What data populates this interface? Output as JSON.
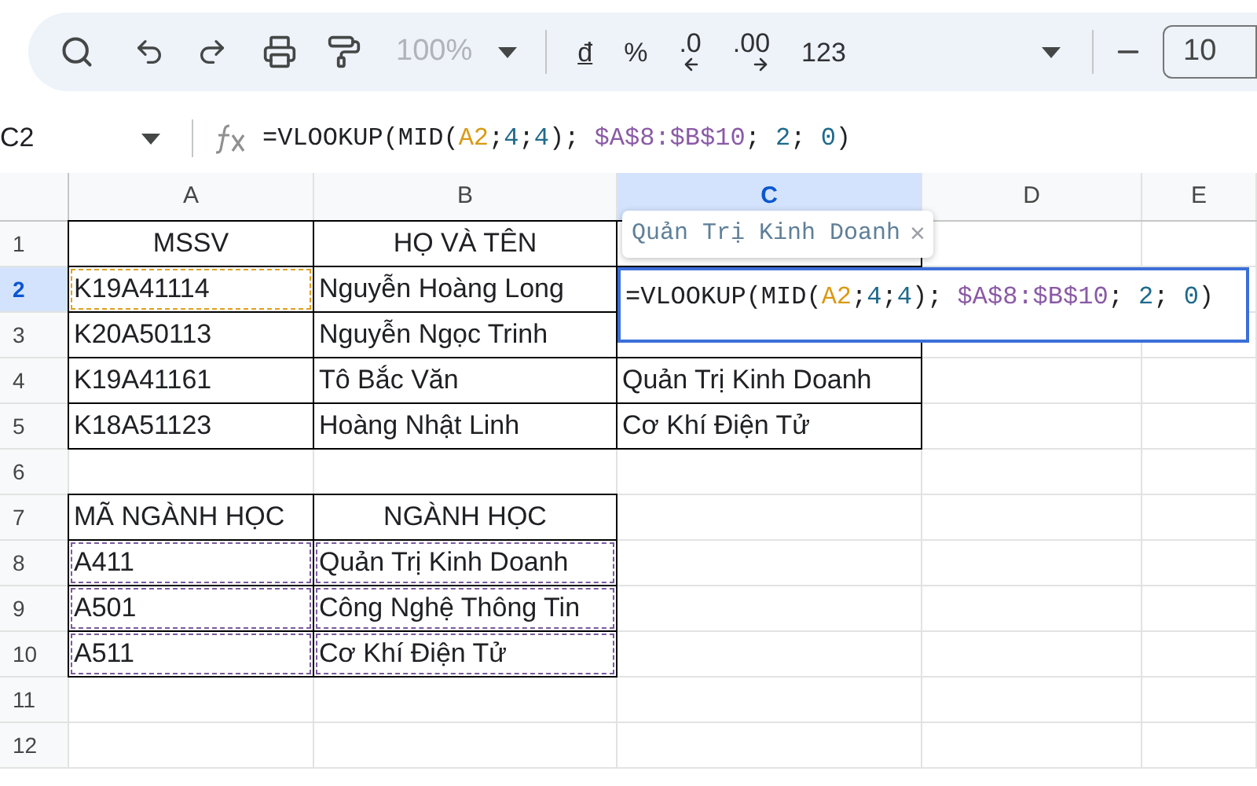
{
  "toolbar": {
    "zoom": "100%",
    "format_buttons": [
      {
        "kind": "plain",
        "label": "đ"
      },
      {
        "kind": "plain",
        "label": "%"
      },
      {
        "kind": "decrease_decimal",
        "label": ".0"
      },
      {
        "kind": "increase_decimal",
        "label": ".00"
      },
      {
        "kind": "plain",
        "label": "123"
      }
    ],
    "font_size": "10"
  },
  "formula_bar": {
    "cell_ref": "C2",
    "formula": [
      {
        "kind": "text",
        "text": "=VLOOKUP(MID("
      },
      {
        "kind": "ref",
        "text": "A2"
      },
      {
        "kind": "text",
        "text": ";"
      },
      {
        "kind": "number",
        "text": "4"
      },
      {
        "kind": "text",
        "text": ";"
      },
      {
        "kind": "number",
        "text": "4"
      },
      {
        "kind": "text",
        "text": "); "
      },
      {
        "kind": "range",
        "text": "$A$8:$B$10"
      },
      {
        "kind": "text",
        "text": "; "
      },
      {
        "kind": "number",
        "text": "2"
      },
      {
        "kind": "text",
        "text": "; "
      },
      {
        "kind": "number",
        "text": "0"
      },
      {
        "kind": "text",
        "text": ")"
      }
    ]
  },
  "sheet": {
    "columns": [
      {
        "label": "A",
        "selected": false
      },
      {
        "label": "B",
        "selected": false
      },
      {
        "label": "C",
        "selected": true
      },
      {
        "label": "D",
        "selected": false
      },
      {
        "label": "E",
        "selected": false
      }
    ],
    "rows": [
      {
        "label": "1",
        "selected": false,
        "cells": [
          {
            "text": "MSSV",
            "centered": true,
            "bordered": true
          },
          {
            "text": "HỌ VÀ TÊN",
            "centered": true,
            "bordered": true
          },
          {
            "centered": false,
            "bordered": true
          }
        ]
      },
      {
        "label": "2",
        "selected": true,
        "cells": [
          {
            "text": "K19A41114",
            "centered": false,
            "bordered": true,
            "color": "#e0a020"
          },
          {
            "text": "Nguyễn Hoàng Long",
            "centered": false,
            "bordered": true
          }
        ]
      },
      {
        "label": "3",
        "selected": false,
        "cells": [
          {
            "text": "K20A50113",
            "centered": false,
            "bordered": true
          },
          {
            "text": "Nguyễn Ngọc Trinh",
            "centered": false,
            "bordered": true
          },
          {
            "centered": false,
            "bordered": true
          }
        ]
      },
      {
        "label": "4",
        "selected": false,
        "cells": [
          {
            "text": "K19A41161",
            "centered": false,
            "bordered": true
          },
          {
            "text": "Tô Bắc Văn",
            "centered": false,
            "bordered": true
          },
          {
            "text": "Quản Trị Kinh Doanh",
            "centered": false,
            "bordered": true
          }
        ]
      },
      {
        "label": "5",
        "selected": false,
        "cells": [
          {
            "text": "K18A51123",
            "centered": false,
            "bordered": true
          },
          {
            "text": "Hoàng Nhật Linh",
            "centered": false,
            "bordered": true
          },
          {
            "text": "Cơ Khí Điện Tử",
            "centered": false,
            "bordered": true
          }
        ]
      },
      {
        "label": "6",
        "selected": false,
        "cells": []
      },
      {
        "label": "7",
        "selected": false,
        "cells": [
          {
            "text": "MÃ NGÀNH HỌC",
            "centered": false,
            "bordered": true
          },
          {
            "text": "NGÀNH HỌC",
            "centered": true,
            "bordered": true
          }
        ]
      },
      {
        "label": "8",
        "selected": false,
        "cells": [
          {
            "text": "A411",
            "centered": false,
            "bordered": true,
            "color": "#7b5a9e"
          },
          {
            "text": "Quản Trị Kinh Doanh",
            "centered": false,
            "bordered": true,
            "color": "#7b5a9e"
          }
        ]
      },
      {
        "label": "9",
        "selected": false,
        "cells": [
          {
            "text": "A501",
            "centered": false,
            "bordered": true,
            "color": "#7b5a9e"
          },
          {
            "text": "Công Nghệ Thông Tin",
            "centered": false,
            "bordered": true,
            "color": "#7b5a9e"
          }
        ]
      },
      {
        "label": "10",
        "selected": false,
        "cells": [
          {
            "text": "A511",
            "centered": false,
            "bordered": true,
            "color": "#7b5a9e"
          },
          {
            "text": "Cơ Khí Điện Tử",
            "centered": false,
            "bordered": true,
            "color": "#7b5a9e"
          }
        ]
      },
      {
        "label": "11",
        "selected": false,
        "cells": []
      },
      {
        "label": "12",
        "selected": false,
        "cells": []
      }
    ]
  },
  "editor": {
    "hint": "Quản Trị Kinh Doanh",
    "close": "×",
    "formula": [
      {
        "kind": "text",
        "text": "=VLOOKUP(MID("
      },
      {
        "kind": "ref",
        "text": "A2"
      },
      {
        "kind": "text",
        "text": ";"
      },
      {
        "kind": "number",
        "text": "4"
      },
      {
        "kind": "text",
        "text": ";"
      },
      {
        "kind": "number",
        "text": "4"
      },
      {
        "kind": "text",
        "text": "); "
      },
      {
        "kind": "range",
        "text": "$A$8:$B$10"
      },
      {
        "kind": "text",
        "text": "; "
      },
      {
        "kind": "number",
        "text": "2"
      },
      {
        "kind": "text",
        "text": "; "
      },
      {
        "kind": "number",
        "text": "0"
      },
      {
        "kind": "text",
        "text": ")"
      }
    ]
  }
}
